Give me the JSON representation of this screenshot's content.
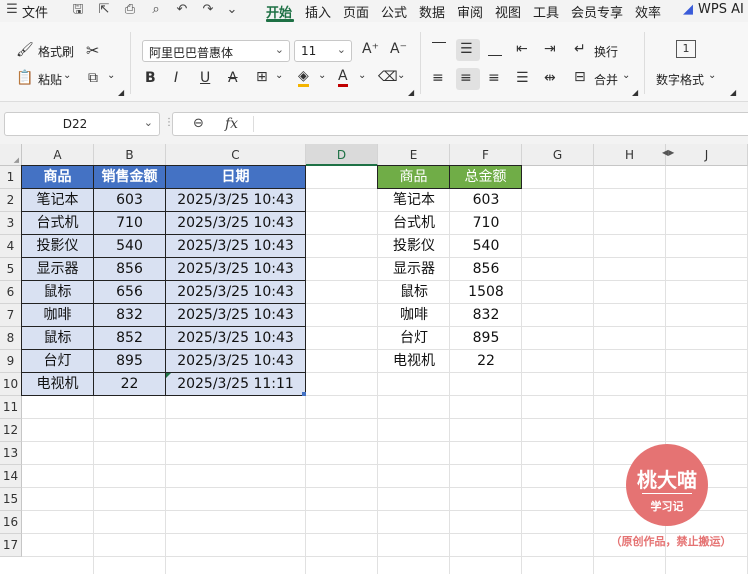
{
  "menu": {
    "file": "文件",
    "tabs": [
      "开始",
      "插入",
      "页面",
      "公式",
      "数据",
      "审阅",
      "视图",
      "工具",
      "会员专享",
      "效率"
    ],
    "ai": "WPS AI"
  },
  "ribbon": {
    "format_painter": "格式刷",
    "paste": "粘贴",
    "font_name": "阿里巴巴普惠体",
    "font_size": "11",
    "wrap": "换行",
    "merge": "合并",
    "number_format": "数字格式"
  },
  "formula_bar": {
    "name_box": "D22",
    "fx": "fx",
    "formula": ""
  },
  "sheet": {
    "columns": [
      "A",
      "B",
      "C",
      "D",
      "E",
      "F",
      "G",
      "H",
      "J"
    ],
    "rows": [
      "1",
      "2",
      "3",
      "4",
      "5",
      "6",
      "7",
      "8",
      "9",
      "10",
      "11",
      "12",
      "13",
      "14",
      "15",
      "16",
      "17"
    ],
    "table1": {
      "headers": [
        "商品",
        "销售金额",
        "日期"
      ],
      "rows": [
        [
          "笔记本",
          "603",
          "2025/3/25 10:43"
        ],
        [
          "台式机",
          "710",
          "2025/3/25 10:43"
        ],
        [
          "投影仪",
          "540",
          "2025/3/25 10:43"
        ],
        [
          "显示器",
          "856",
          "2025/3/25 10:43"
        ],
        [
          "鼠标",
          "656",
          "2025/3/25 10:43"
        ],
        [
          "咖啡",
          "832",
          "2025/3/25 10:43"
        ],
        [
          "鼠标",
          "852",
          "2025/3/25 10:43"
        ],
        [
          "台灯",
          "895",
          "2025/3/25 10:43"
        ],
        [
          "电视机",
          "22",
          "2025/3/25 11:11"
        ]
      ]
    },
    "table2": {
      "headers": [
        "商品",
        "总金额"
      ],
      "rows": [
        [
          "笔记本",
          "603"
        ],
        [
          "台式机",
          "710"
        ],
        [
          "投影仪",
          "540"
        ],
        [
          "显示器",
          "856"
        ],
        [
          "鼠标",
          "1508"
        ],
        [
          "咖啡",
          "832"
        ],
        [
          "台灯",
          "895"
        ],
        [
          "电视机",
          "22"
        ]
      ]
    }
  },
  "watermark": {
    "title": "桃大喵",
    "subtitle": "学习记",
    "note": "（原创作品，禁止搬运）"
  },
  "colors": {
    "table1_header": "#4472c4",
    "table1_body": "#d9e1f2",
    "table2_header": "#70ad47",
    "accent": "#1e7145",
    "watermark": "#e57373"
  }
}
